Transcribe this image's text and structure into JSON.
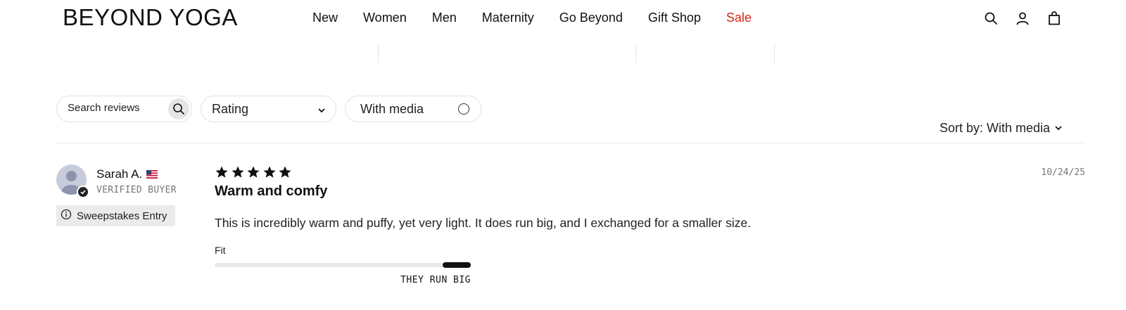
{
  "header": {
    "logo": "BEYOND YOGA",
    "nav": [
      {
        "label": "New"
      },
      {
        "label": "Women"
      },
      {
        "label": "Men"
      },
      {
        "label": "Maternity"
      },
      {
        "label": "Go Beyond"
      },
      {
        "label": "Gift Shop"
      },
      {
        "label": "Sale",
        "color": "#d62718"
      }
    ],
    "icons": [
      "search-icon",
      "account-icon",
      "shopping-bag-icon"
    ]
  },
  "controls": {
    "search_placeholder": "Search reviews",
    "rating_label": "Rating",
    "media_label": "With media",
    "sort_label": "Sort by: With media"
  },
  "review": {
    "name": "Sarah A.",
    "flag": "us-flag-icon",
    "verified": "VERIFIED BUYER",
    "sweepstakes": "Sweepstakes Entry",
    "rating": 5,
    "date": "10/24/25",
    "title": "Warm and comfy",
    "body": "This is incredibly warm and puffy, yet very light. It does run big, and I exchanged for a smaller size.",
    "fit": {
      "label": "Fit",
      "value_label": "THEY RUN BIG",
      "level": 1.0
    }
  }
}
